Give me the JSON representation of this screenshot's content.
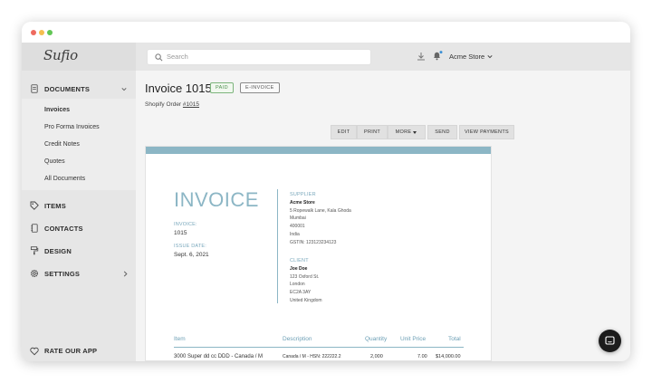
{
  "app": {
    "brand": "Sufio"
  },
  "colors": {
    "accent": "#8cb6c5",
    "paid_green": "#4f9150",
    "close": "#ee6a5f",
    "minimize": "#f5be4f",
    "zoom": "#62c655"
  },
  "window_controls": [
    "close",
    "minimize",
    "zoom"
  ],
  "header": {
    "search_placeholder": "Search",
    "store_name": "Acme Store",
    "icons": [
      "download-icon",
      "bell-icon",
      "chevron-down-icon"
    ]
  },
  "sidebar": {
    "documents": {
      "label": "DOCUMENTS",
      "items": [
        "Invoices",
        "Pro Forma Invoices",
        "Credit Notes",
        "Quotes",
        "All Documents"
      ]
    },
    "nav": [
      {
        "label": "ITEMS",
        "icon": "tag-icon"
      },
      {
        "label": "CONTACTS",
        "icon": "address-book-icon"
      },
      {
        "label": "DESIGN",
        "icon": "paint-roller-icon"
      },
      {
        "label": "SETTINGS",
        "icon": "gear-icon"
      }
    ],
    "rate": {
      "label": "RATE OUR APP",
      "icon": "heart-icon"
    }
  },
  "invoice_header": {
    "title": "Invoice 1015",
    "badges": [
      "PAID",
      "E-INVOICE"
    ],
    "order_prefix": "Shopify Order",
    "order_link": "#1015"
  },
  "toolbar": {
    "edit": "EDIT",
    "print": "PRINT",
    "more": "MORE",
    "send": "SEND",
    "view_payments": "VIEW PAYMENTS"
  },
  "document": {
    "heading": "INVOICE",
    "invoice_label": "INVOICE:",
    "invoice_number": "1015",
    "issue_label": "ISSUE DATE:",
    "issue_date": "Sept. 6, 2021",
    "supplier_label": "SUPPLIER",
    "supplier": [
      "Acme Store",
      "5 Ropewalk Lane, Kala Ghoda",
      "Mumbai",
      "400001",
      "India",
      "GSTIN: 123123234123"
    ],
    "client_label": "CLIENT",
    "client": [
      "Joe Doe",
      "123 Oxford St.",
      "London",
      "EC2A 3AY",
      "United Kingdom"
    ],
    "table": {
      "headers": [
        "Item",
        "Description",
        "Quantity",
        "Unit Price",
        "Total"
      ],
      "rows": [
        [
          "3000 Super dd cc DDD - Canada / M",
          "Canada / M - HSN: 222222.2",
          "2,000",
          "7.00",
          "$14,000.00"
        ]
      ]
    }
  }
}
